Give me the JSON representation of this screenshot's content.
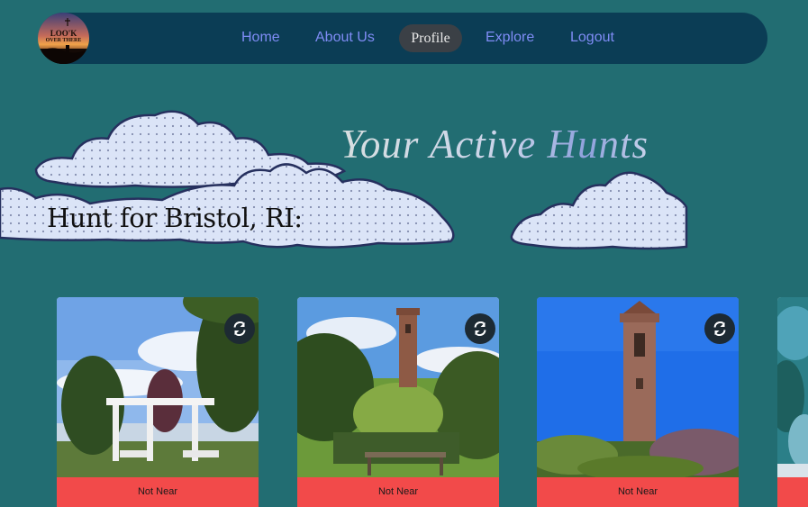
{
  "nav": {
    "logo_line1": "LOO'K",
    "logo_line2": "OVER THERE",
    "home": "Home",
    "about": "About Us",
    "profile": "Profile",
    "explore": "Explore",
    "logout": "Logout"
  },
  "heading": "Your Active Hunts",
  "subheading": "Hunt for Bristol, RI:",
  "cards": [
    {
      "status": "Not Near",
      "icon": "refresh-icon"
    },
    {
      "status": "Not Near",
      "icon": "refresh-icon"
    },
    {
      "status": "Not Near",
      "icon": "refresh-icon"
    },
    {
      "status": "",
      "icon": ""
    }
  ],
  "colors": {
    "background": "#226d72",
    "navbar": "#0b3d55",
    "nav_link": "#7f8cf5",
    "active_pill": "#3b4046",
    "status_bar": "#f24a4a"
  }
}
